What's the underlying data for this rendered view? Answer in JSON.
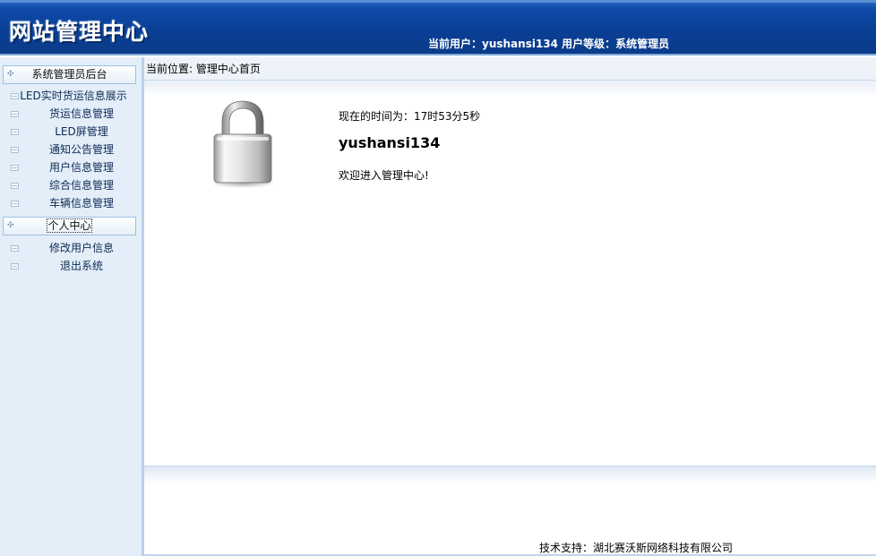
{
  "header": {
    "title": "网站管理中心",
    "user_line": "当前用户：yushansi134 用户等级：系统管理员"
  },
  "sidebar": {
    "sections": [
      {
        "title": "系统管理员后台",
        "items": [
          "LED实时货运信息展示",
          "货运信息管理",
          "LED屏管理",
          "通知公告管理",
          "用户信息管理",
          "综合信息管理",
          "车辆信息管理"
        ]
      },
      {
        "title": "个人中心",
        "items": [
          "修改用户信息",
          "退出系统"
        ]
      }
    ]
  },
  "main": {
    "breadcrumb": "当前位置: 管理中心首页",
    "time_line": "现在的时间为：17时53分5秒",
    "username": "yushansi134",
    "welcome": "欢迎进入管理中心!",
    "lock_icon": "padlock-icon"
  },
  "footer": {
    "text": "技术支持：湖北赛沃斯网络科技有限公司"
  }
}
